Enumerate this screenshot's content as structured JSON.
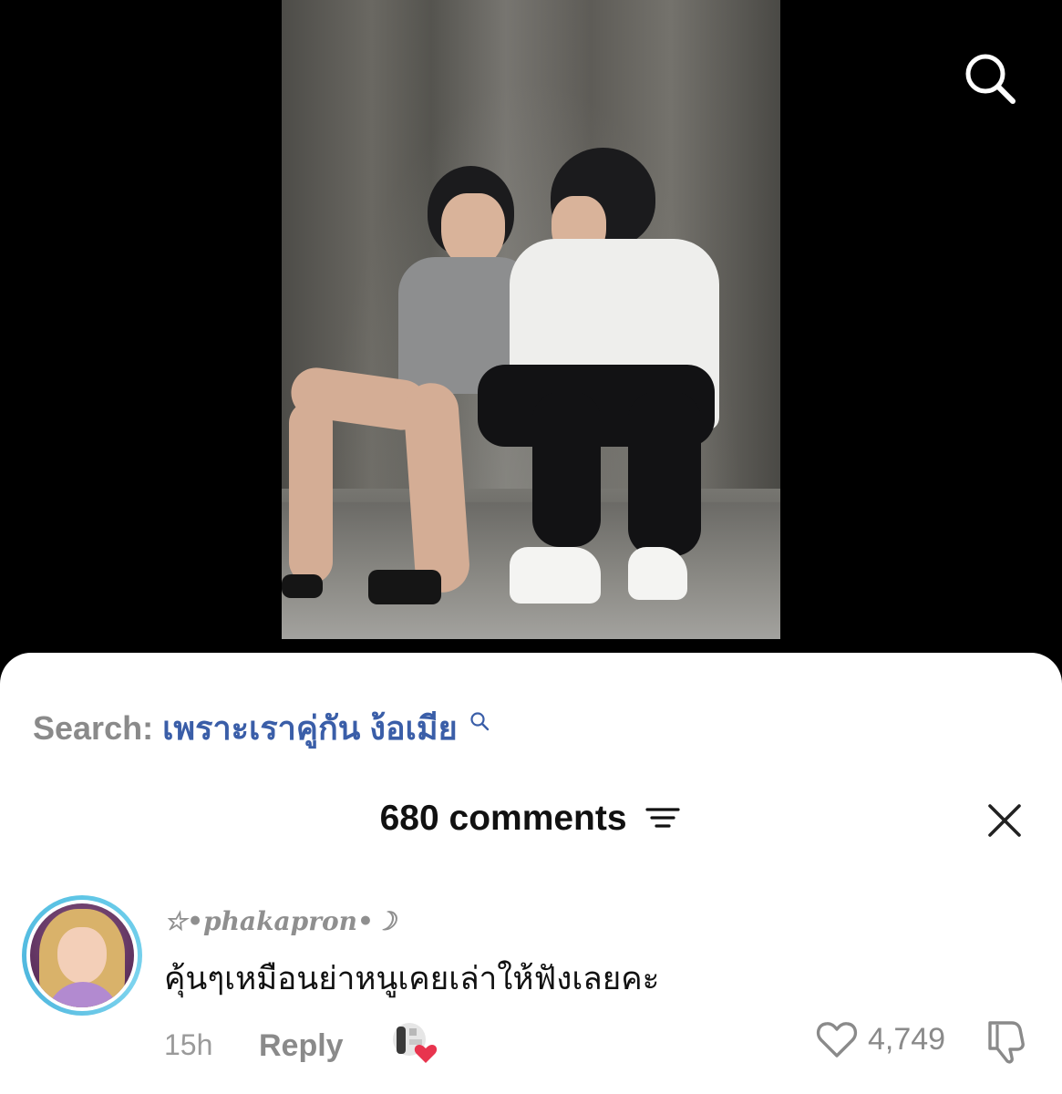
{
  "video": {
    "description_icon": "video-frame"
  },
  "top_bar": {
    "search_icon": "search-icon"
  },
  "sheet": {
    "search_prefix": "Search:",
    "search_query": "เพราะเราคู่กัน ง้อเมีย",
    "comments_title": "680 comments",
    "close_icon": "close-icon",
    "sort_icon": "sort-icon"
  },
  "comment": {
    "username": "☆•phakapron•☽",
    "text": "คุ้นๆเหมือนย่าหนูเคยเล่าให้ฟังเลยคะ",
    "time": "15h",
    "reply_label": "Reply",
    "likes": "4,749",
    "like_icon": "heart-outline-icon",
    "dislike_icon": "thumbs-down-icon",
    "creator_liked_icon": "creator-liked-icon"
  },
  "colors": {
    "query_blue": "#3a5ea8",
    "avatar_ring": "#5fc6e6",
    "creator_heart": "#e8344e"
  }
}
